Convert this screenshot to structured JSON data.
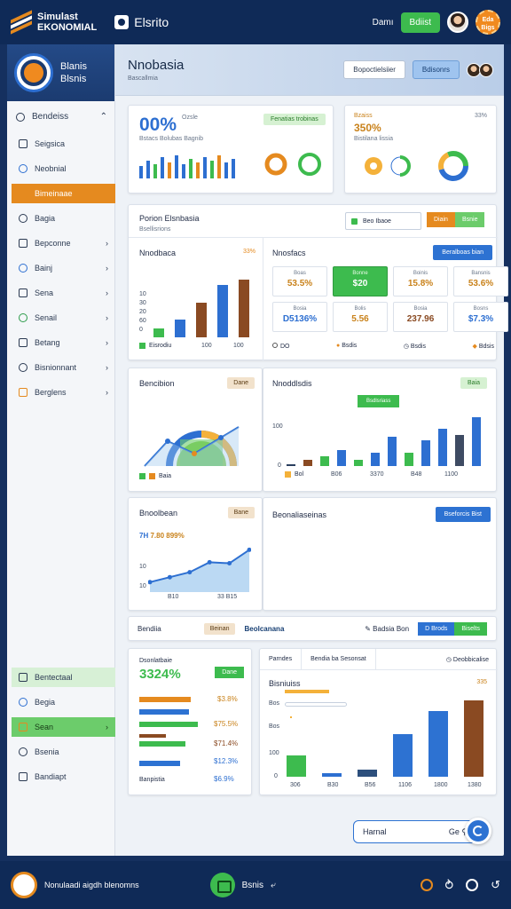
{
  "topbar": {
    "brand_line1": "Simulast",
    "brand_line2": "EKONOMIAL",
    "app_name": "Elsrito",
    "link": "Damı",
    "button": "Bdiist",
    "badge_line1": "Eda",
    "badge_line2": "Bigs"
  },
  "colors": {
    "navy": "#0f2a57",
    "blue": "#2d6fd1",
    "orange": "#e58a1f",
    "green": "#3dbb4e",
    "brown": "#8a4a22"
  },
  "sidebar": {
    "head_line1": "Blanis",
    "head_line2": "Blsnis",
    "section_title": "Bendeiss",
    "items": [
      {
        "label": "Seigsica",
        "icon": "document-icon"
      },
      {
        "label": "Neobnial",
        "icon": "chart-icon"
      },
      {
        "label": "Bimeinaae",
        "icon": "table-icon",
        "active": true
      },
      {
        "label": "Bagia",
        "icon": "list-icon"
      },
      {
        "label": "Bepconne",
        "icon": "grid-icon",
        "chev": true
      },
      {
        "label": "Bainj",
        "icon": "folder-icon",
        "chev": true
      },
      {
        "label": "Sena",
        "icon": "globe-icon",
        "chev": true
      },
      {
        "label": "Senail",
        "icon": "settings-icon",
        "chev": true
      },
      {
        "label": "Betang",
        "icon": "calendar-icon",
        "chev": true
      },
      {
        "label": "Bisnionnant",
        "icon": "briefcase-icon",
        "chev": true
      },
      {
        "label": "Berglens",
        "icon": "report-icon",
        "chev": true
      }
    ],
    "lower_items": [
      {
        "label": "Bentectaal",
        "icon": "pin-icon"
      },
      {
        "label": "Begia",
        "icon": "link-icon"
      },
      {
        "label": "Sean",
        "icon": "user-icon",
        "chev": true
      },
      {
        "label": "Bsenia",
        "icon": "mail-icon"
      },
      {
        "label": "Bandiapt",
        "icon": "help-icon"
      }
    ]
  },
  "header": {
    "title": "Nnobasia",
    "subtitle": "Bascallmia",
    "btn1": "Bopoctielsiier",
    "btn2": "Bdisonrs"
  },
  "kpi1": {
    "value": "00%",
    "label": "Ozsle",
    "sub": "Bstacs Bolubas Bagnib",
    "pill": "Fenatias trobinas"
  },
  "kpi2": {
    "title": "Bzaiss",
    "value": "350%",
    "sub": "Bistilana lissia",
    "corner": "33%"
  },
  "section1": {
    "title": "Porion Elsnbasia",
    "sub": "Bsellisrions",
    "btn_outline": "Beo Ibaoe",
    "pill_orange": "Diain",
    "pill_green": "Bsnie"
  },
  "chart1": {
    "title": "Nnodbaca",
    "corner": "33%",
    "ticks": [
      "10",
      "30",
      "20",
      "60",
      "0"
    ],
    "legend": "Eisrodiu",
    "xlabels": [
      "100",
      "100"
    ]
  },
  "chart_data": [
    {
      "type": "bar",
      "title": "Nnodbaca",
      "values": [
        15,
        30,
        60,
        90,
        100
      ],
      "colors": [
        "#3dbb4e",
        "#2d6fd1",
        "#8a4a22",
        "#2d6fd1",
        "#8a4a22"
      ],
      "ylim": [
        0,
        110
      ]
    },
    {
      "type": "bar",
      "title": "Nnoddlsdis",
      "values": [
        2,
        6,
        10,
        16,
        6,
        14,
        30,
        14,
        26,
        38,
        32,
        50
      ],
      "colors": [
        "#2a3f5f",
        "#8a4a22",
        "#3dbb4e",
        "#2d6fd1",
        "#3dbb4e",
        "#2d6fd1",
        "#2d6fd1",
        "#3dbb4e",
        "#2d6fd1",
        "#2d6fd1",
        "#3e4b63",
        "#2d6fd1"
      ],
      "ylim": [
        0,
        60
      ]
    },
    {
      "type": "area",
      "title": "Bnoolbean",
      "values": [
        20,
        30,
        40,
        60,
        58,
        85
      ],
      "ylim": [
        0,
        100
      ]
    },
    {
      "type": "bar",
      "title": "Bisniuiss",
      "values": [
        60,
        10,
        20,
        120,
        185,
        215
      ],
      "colors": [
        "#3dbb4e",
        "#2d6fd1",
        "#2d4f7c",
        "#2d72d2",
        "#2d72d2",
        "#8a4a22"
      ],
      "ylim": [
        0,
        230
      ]
    }
  ],
  "metrics": {
    "title": "Nnosfacs",
    "button": "Beralboas bian",
    "cells": [
      {
        "label": "Boas",
        "value": "53.5%",
        "color": "#c9821b"
      },
      {
        "label": "Bonne",
        "value": "$20",
        "color": "#ffffff",
        "green": true
      },
      {
        "label": "Boinis",
        "value": "15.8%",
        "color": "#c9821b"
      },
      {
        "label": "Bansnis",
        "value": "53.6%",
        "color": "#c9821b"
      },
      {
        "label": "Bosia",
        "value": "D5136%",
        "color": "#2d6fd1"
      },
      {
        "label": "Bolis",
        "value": "5.56",
        "color": "#c9821b"
      },
      {
        "label": "Bosia",
        "value": "237.96",
        "color": "#8a4a22"
      },
      {
        "label": "Bosns",
        "value": "$7.3%",
        "color": "#2d6fd1"
      }
    ],
    "foot": [
      "DO",
      "Bsdis",
      "Bsdis",
      "Bdsis"
    ]
  },
  "donut_card": {
    "title": "Bencibion",
    "pill": "Dane",
    "legend": "Baia"
  },
  "chart2": {
    "title": "Nnoddlsdis",
    "pill": "Baia",
    "green_label": "Bsdlsriass",
    "ylabels": [
      "100",
      "0"
    ],
    "xlabels": [
      "Bol",
      "B06",
      "3370",
      "B48",
      "1100"
    ]
  },
  "chart3": {
    "title": "Bnoolbean",
    "pill": "Bane",
    "stat": "7.80 899%",
    "stat_prefix": "7H",
    "ticks": [
      "10",
      "10"
    ],
    "xlabels": [
      "B10",
      "33 B15"
    ]
  },
  "empty_card": {
    "title": "Beonaliaseinas",
    "button": "Bseforcis Bist"
  },
  "toolbar": {
    "label": "Bendiia",
    "pill": "Beinan",
    "active": "Beolcanana",
    "link": "Badsia Bon",
    "btn_blue": "D Brods",
    "btn_green": "Biselts"
  },
  "stats_card": {
    "title": "Dsonlatbaie",
    "value": "3324%",
    "pill": "Dane",
    "rows": [
      "$3.8%",
      "$75.5%",
      "$71.4%",
      "$12.3%",
      "$6.9%"
    ],
    "foot": "Banpistia"
  },
  "chart4": {
    "tab1": "Parndes",
    "tab2": "Bendia ba Sesonsat",
    "tab3": "Deobbicalise",
    "title": "Bisniuiss",
    "corner": "335",
    "ylabels": [
      "Bos",
      "Bos",
      "100",
      "0"
    ],
    "xlabels": [
      "306",
      "B30",
      "B56",
      "1106",
      "1800",
      "1380"
    ]
  },
  "search": {
    "placeholder": "Harnal",
    "icon_label": "Ge"
  },
  "bottombar": {
    "text": "Nonulaadi aigdh blenomns",
    "center": "Bsnis"
  }
}
